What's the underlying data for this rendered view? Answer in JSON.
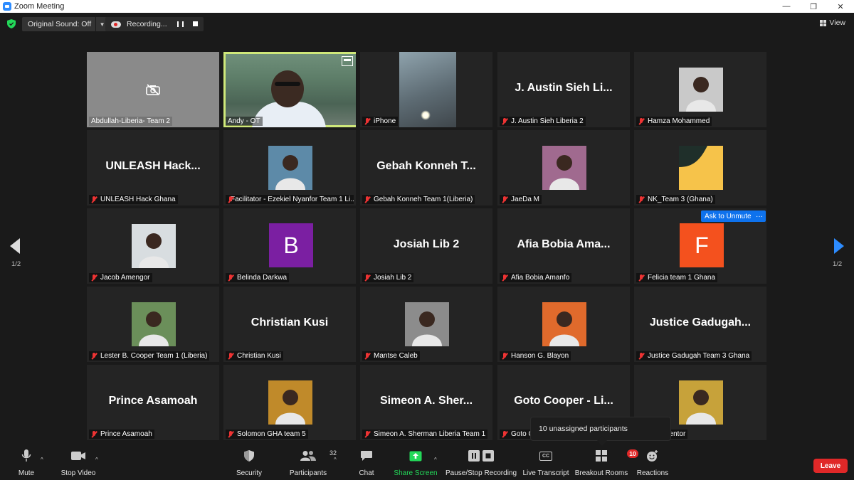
{
  "window": {
    "title": "Zoom Meeting",
    "controls": [
      "—",
      "❐",
      "✕"
    ]
  },
  "topbar": {
    "sound_label": "Original Sound: Off",
    "recording_label": "Recording...",
    "view_label": "View"
  },
  "pagination": {
    "left": "1/2",
    "right": "1/2"
  },
  "participants": [
    {
      "name": "Abdullah-Liberia- Team 2",
      "big": "",
      "type": "camoff"
    },
    {
      "name": "Andy - OT",
      "big": "",
      "type": "video"
    },
    {
      "name": "iPhone",
      "big": "",
      "type": "iphone"
    },
    {
      "name": "J. Austin Sieh Liberia 2",
      "big": "J. Austin Sieh Li...",
      "type": "text"
    },
    {
      "name": "Hamza Mohammed",
      "big": "",
      "type": "photo",
      "color": "#c9c9c9"
    },
    {
      "name": "UNLEASH Hack Ghana",
      "big": "UNLEASH  Hack...",
      "type": "text"
    },
    {
      "name": "Facilitator - Ezekiel Nyanfor Team 1 Li...",
      "big": "",
      "type": "photo",
      "color": "#5d8aa8"
    },
    {
      "name": "Gebah Konneh Team 1(Liberia)",
      "big": "Gebah Konneh T...",
      "type": "text"
    },
    {
      "name": "JaeDa M",
      "big": "",
      "type": "photo",
      "color": "#a06a8f"
    },
    {
      "name": "NK_Team 3 (Ghana)",
      "big": "",
      "type": "nk"
    },
    {
      "name": "Jacob Amengor",
      "big": "",
      "type": "photo",
      "color": "#d8dde0"
    },
    {
      "name": "Belinda Darkwa",
      "big": "",
      "type": "letter",
      "letter": "B",
      "color": "#7b1fa2"
    },
    {
      "name": "Josiah Lib 2",
      "big": "Josiah Lib 2",
      "type": "text"
    },
    {
      "name": "Afia Bobia Amanfo",
      "big": "Afia Bobia Ama...",
      "type": "text"
    },
    {
      "name": "Felicia team 1 Ghana",
      "big": "",
      "type": "letter",
      "letter": "F",
      "color": "#f4511e"
    },
    {
      "name": "Lester B. Cooper Team 1 (Liberia)",
      "big": "",
      "type": "photo",
      "color": "#6b8f5a"
    },
    {
      "name": "Christian Kusi",
      "big": "Christian Kusi",
      "type": "text"
    },
    {
      "name": "Mantse Caleb",
      "big": "",
      "type": "photo",
      "color": "#8c8c8c"
    },
    {
      "name": "Hanson G. Blayon",
      "big": "",
      "type": "photo",
      "color": "#e06a2c"
    },
    {
      "name": "Justice Gadugah Team 3 Ghana",
      "big": "Justice  Gadugah...",
      "type": "text"
    },
    {
      "name": "Prince Asamoah",
      "big": "Prince Asamoah",
      "type": "text"
    },
    {
      "name": "Solomon GHA team 5",
      "big": "",
      "type": "photo",
      "color": "#c08a2a"
    },
    {
      "name": "Simeon A. Sherman Liberia Team 1",
      "big": "Simeon A. Sher...",
      "type": "text"
    },
    {
      "name": "Goto C",
      "big": "Goto Cooper - Li...",
      "type": "text"
    },
    {
      "name": "uel - Mentor",
      "big": "",
      "type": "photo",
      "color": "#c7a23a"
    }
  ],
  "unmute_button": "Ask to Unmute",
  "more_button": "···",
  "tooltip": "10 unassigned participants",
  "toolbar": {
    "mute": "Mute",
    "stop_video": "Stop Video",
    "security": "Security",
    "participants": "Participants",
    "participants_count": "32",
    "chat": "Chat",
    "share_screen": "Share Screen",
    "pause_recording": "Pause/Stop Recording",
    "live_transcript": "Live Transcript",
    "cc": "CC",
    "breakout_rooms": "Breakout Rooms",
    "breakout_badge": "10",
    "reactions": "Reactions",
    "leave": "Leave"
  },
  "colors": {
    "accent": "#2d8cff",
    "share_green": "#23d959",
    "leave_red": "#e02828",
    "active_outline": "#cfe87a"
  }
}
